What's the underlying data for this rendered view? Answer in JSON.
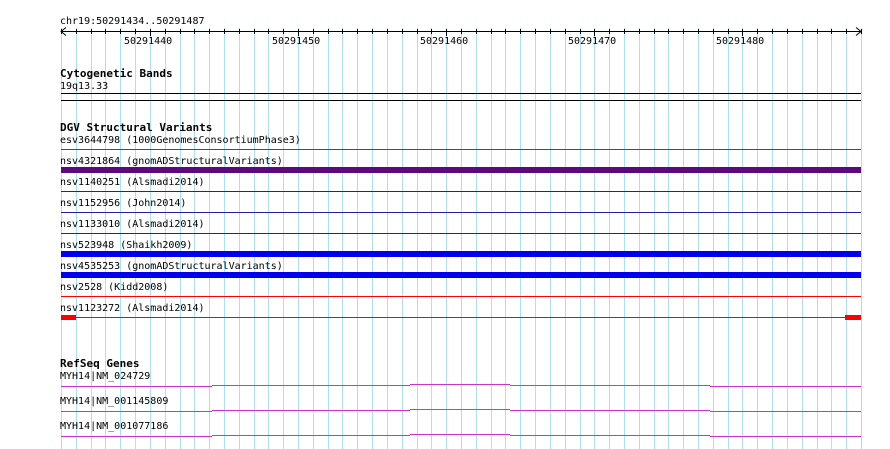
{
  "ruler": {
    "location": "chr19:50291434..50291487",
    "start": 50291434,
    "end": 50291487,
    "tick_labels": [
      "50291440",
      "50291450",
      "50291460",
      "50291470",
      "50291480"
    ]
  },
  "tracks": {
    "cytoband": {
      "title": "Cytogenetic Bands",
      "band": "19q13.33"
    },
    "dgv": {
      "title": "DGV Structural Variants",
      "features": [
        {
          "label": "esv3644798 (1000GenomesConsortiumPhase3)",
          "color": "#ff0000",
          "style": "thin"
        },
        {
          "label": "nsv4321864 (gnomADStructuralVariants)",
          "color": "#5a0a7a",
          "style": "thick"
        },
        {
          "label": "nsv1140251 (Alsmadi2014)",
          "color": "#2020a0",
          "style": "thin"
        },
        {
          "label": "nsv1152956 (John2014)",
          "color": "#2020a0",
          "style": "thin"
        },
        {
          "label": "nsv1133010 (Alsmadi2014)",
          "color": "#2020a0",
          "style": "thin"
        },
        {
          "label": "nsv523948 (Shaikh2009)",
          "color": "#0000ee",
          "style": "thick"
        },
        {
          "label": "nsv4535253 (gnomADStructuralVariants)",
          "color": "#0000ee",
          "style": "thick"
        },
        {
          "label": "nsv2528 (Kidd2008)",
          "color": "#ff0000",
          "style": "thin"
        },
        {
          "label": "nsv1123272 (Alsmadi2014)",
          "color": "#ff0000",
          "style": "end-blocks"
        }
      ]
    },
    "refseq": {
      "title": "RefSeq Genes",
      "color": "#cc33cc",
      "genes": [
        {
          "label": "MYH14|NM_024729"
        },
        {
          "label": "MYH14|NM_001145809"
        },
        {
          "label": "MYH14|NM_001077186"
        }
      ]
    }
  },
  "colors": {
    "grid": "#aee0f0",
    "axis": "#000000"
  }
}
